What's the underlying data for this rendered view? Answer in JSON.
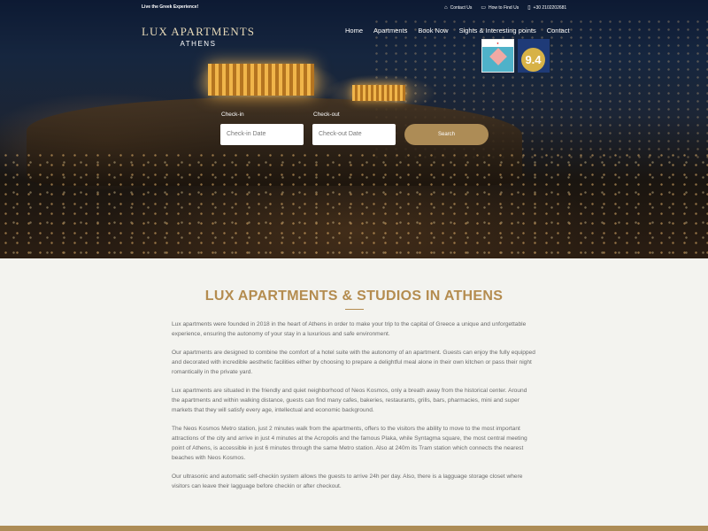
{
  "topbar": {
    "tagline": "Live the Greek Experience!",
    "links": [
      {
        "icon": "home-icon",
        "label": "Contact Us"
      },
      {
        "icon": "map-icon",
        "label": "How to Find Us"
      },
      {
        "icon": "phone-icon",
        "label": "+30 2102202681"
      }
    ]
  },
  "logo": {
    "line1": "LUX APARTMENTS",
    "line2": "ATHENS"
  },
  "nav": [
    "Home",
    "Apartments",
    "Book Now",
    "Sights & Interesting points",
    "Contact"
  ],
  "badges": {
    "booking_score": "9.4"
  },
  "booking": {
    "checkin_label": "Check-in",
    "checkout_label": "Check-out",
    "checkin_placeholder": "Check-in Date",
    "checkout_placeholder": "Check-out Date",
    "search_label": "Search"
  },
  "content": {
    "heading": "LUX APARTMENTS & STUDIOS IN ATHENS",
    "paragraphs": [
      "Lux apartments were founded in 2018 in the heart of Athens in order to make your trip to the capital of Greece a unique and unforgettable experience, ensuring the autonomy of your stay in a luxurious and safe environment.",
      "Our apartments are designed to combine the comfort of a hotel suite with the autonomy of an apartment. Guests can enjoy the fully equipped and decorated with incredible aesthetic facilities either by choosing to prepare a delightful meal alone in their own kitchen or pass their night romantically in the private yard.",
      "Lux apartments are situated in the friendly and quiet neighborhood of Neos Kosmos, only a breath away from the historical center. Around the apartments and within walking distance, guests can find many cafes, bakeries, restaurants, grills, bars, pharmacies, mini and super markets that they will satisfy every age, intellectual and economic background.",
      "The Neos Kosmos Metro station, just 2 minutes walk from the apartments, offers to the visitors the ability to move to the most important attractions of the city and arrive in just 4 minutes at the Acropolis and the famous Plaka, while Syntagma square, the most central meeting point of Athens, is accessible in just 6 minutes through the same Metro station. Also at 240m its Tram station which connects the nearest beaches with Neos Kosmos.",
      "Our ultrasonic and automatic self-checkin system allows the guests to arrive 24h per day. Also, there is a lagguage storage closet where visitors can leave their lagguage before checkin or after checkout."
    ]
  },
  "colors": {
    "accent": "#ad8c56",
    "heading": "#b48c4f"
  }
}
